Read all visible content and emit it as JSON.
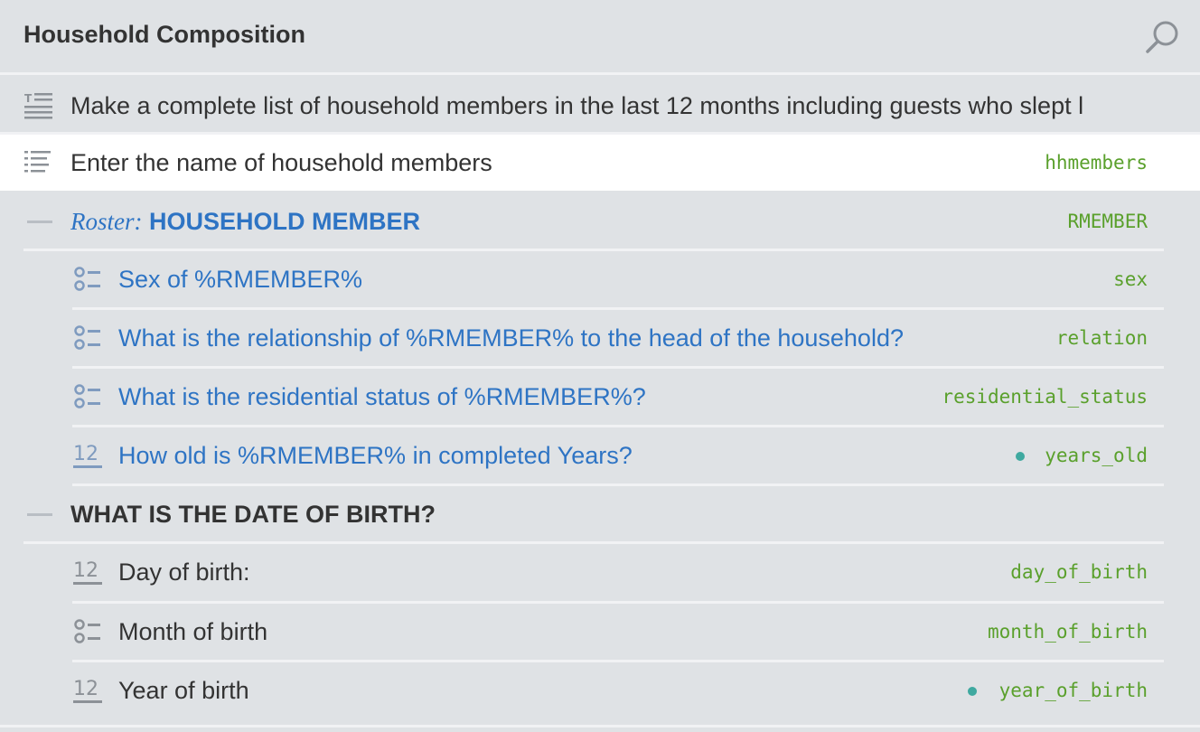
{
  "header": {
    "title": "Household Composition"
  },
  "rows": [
    {
      "label": "Make a complete list of household members in the last 12 months including guests who slept l",
      "var": ""
    },
    {
      "label": "Enter the name of household members",
      "var": "hhmembers"
    },
    {
      "roster_prefix": "Roster:",
      "label": "HOUSEHOLD MEMBER",
      "var": "RMEMBER"
    },
    {
      "label": "Sex of %RMEMBER%",
      "var": "sex"
    },
    {
      "label": "What is the relationship of %RMEMBER% to the head of the household?",
      "var": "relation"
    },
    {
      "label": "What is the residential status of %RMEMBER%?",
      "var": "residential_status"
    },
    {
      "label": "How old is %RMEMBER% in completed Years?",
      "var": "years_old"
    },
    {
      "label": "WHAT IS THE DATE OF BIRTH?",
      "var": ""
    },
    {
      "label": "Day of birth:",
      "var": "day_of_birth"
    },
    {
      "label": "Month of birth",
      "var": "month_of_birth"
    },
    {
      "label": "Year of birth",
      "var": "year_of_birth"
    }
  ],
  "colors": {
    "background": "#dfe2e5",
    "link_blue": "#2e74c4",
    "variable_green": "#5aa02c",
    "dot_teal": "#3fa9a0"
  },
  "icons": [
    "search-icon",
    "static-text-icon",
    "text-list-icon",
    "collapse-icon",
    "single-select-icon",
    "numeric-icon"
  ]
}
